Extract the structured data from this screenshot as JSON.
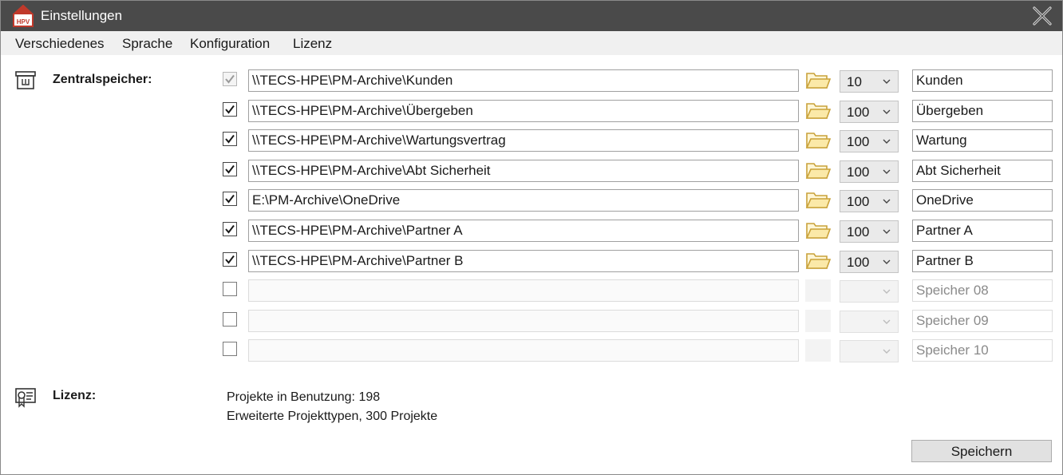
{
  "window": {
    "title": "Einstellungen",
    "logo_text": "HPV",
    "icons": {
      "app": "house-logo-icon",
      "close": "close-icon"
    }
  },
  "menu": [
    "Verschiedenes",
    "Sprache",
    "Konfiguration",
    "Lizenz"
  ],
  "storage": {
    "label": "Zentralspeicher:",
    "icon": "storage-icon",
    "rows": [
      {
        "checked": true,
        "enabled": false,
        "path": "\\\\TECS-HPE\\PM-Archive\\Kunden",
        "limit": "10",
        "name": "Kunden",
        "active": true
      },
      {
        "checked": true,
        "enabled": true,
        "path": "\\\\TECS-HPE\\PM-Archive\\Übergeben",
        "limit": "100",
        "name": "Übergeben",
        "active": true
      },
      {
        "checked": true,
        "enabled": true,
        "path": "\\\\TECS-HPE\\PM-Archive\\Wartungsvertrag",
        "limit": "100",
        "name": "Wartung",
        "active": true
      },
      {
        "checked": true,
        "enabled": true,
        "path": "\\\\TECS-HPE\\PM-Archive\\Abt Sicherheit",
        "limit": "100",
        "name": "Abt Sicherheit",
        "active": true
      },
      {
        "checked": true,
        "enabled": true,
        "path": "E:\\PM-Archive\\OneDrive",
        "limit": "100",
        "name": "OneDrive",
        "active": true
      },
      {
        "checked": true,
        "enabled": true,
        "path": "\\\\TECS-HPE\\PM-Archive\\Partner A",
        "limit": "100",
        "name": "Partner A",
        "active": true
      },
      {
        "checked": true,
        "enabled": true,
        "path": "\\\\TECS-HPE\\PM-Archive\\Partner B",
        "limit": "100",
        "name": "Partner B",
        "active": true
      },
      {
        "checked": false,
        "enabled": true,
        "path": "",
        "limit": "",
        "name": "Speicher 08",
        "active": false
      },
      {
        "checked": false,
        "enabled": true,
        "path": "",
        "limit": "",
        "name": "Speicher 09",
        "active": false
      },
      {
        "checked": false,
        "enabled": true,
        "path": "",
        "limit": "",
        "name": "Speicher 10",
        "active": false
      }
    ]
  },
  "license": {
    "label": "Lizenz:",
    "icon": "certificate-icon",
    "line1": "Projekte in Benutzung: 198",
    "line2": "Erweiterte Projekttypen, 300 Projekte"
  },
  "footer": {
    "save_label": "Speichern"
  },
  "colors": {
    "titlebar": "#4a4a4a",
    "folder": "#c9a23a",
    "check": "#1a1a1a"
  }
}
